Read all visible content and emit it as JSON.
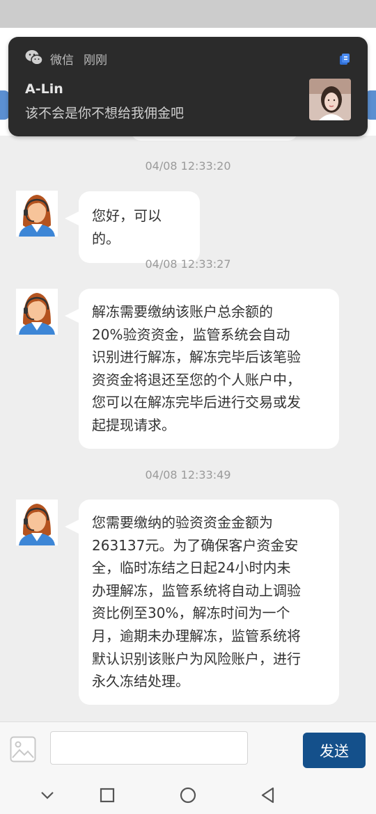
{
  "notification": {
    "app": "微信",
    "time": "刚刚",
    "sender": "A-Lin",
    "message": "该不会是你不想给我佣金吧",
    "app_icon": "wechat-icon",
    "badge_icon": "message-badge-icon"
  },
  "chat": {
    "messages": [
      {
        "timestamp": "04/08 12:33:20",
        "lines": [
          "您好，可以的。"
        ]
      },
      {
        "timestamp": "04/08 12:33:27",
        "lines": [
          "解冻需要缴纳该账户总余额的",
          "20%验资资金，监管系统会自动",
          "识别进行解冻，解冻完毕后该笔验",
          "资资金将退还至您的个人账户中，",
          "您可以在解冻完毕后进行交易或发",
          "起提现请求。"
        ]
      },
      {
        "timestamp": "04/08 12:33:49",
        "lines": [
          "您需要缴纳的验资资金金额为",
          "263137元。为了确保客户资金安",
          "全，临时冻结之日起24小时内未",
          "办理解冻，监管系统将自动上调验",
          "资比例至30%，解冻时间为一个",
          "月，逾期未办理解冻，监管系统将",
          "默认识别该账户为风险账户，进行",
          "永久冻结处理。"
        ]
      }
    ]
  },
  "composer": {
    "image_icon": "image-icon",
    "input_value": "",
    "send_label": "发送"
  },
  "navbar": [
    "chevron-down-icon",
    "recents-square-icon",
    "home-circle-icon",
    "back-triangle-icon"
  ],
  "colors": {
    "send_button": "#14508b",
    "notification_bg": "#2b2b2b",
    "page_bg": "#eeeeee",
    "bubble_bg": "#ffffff"
  }
}
